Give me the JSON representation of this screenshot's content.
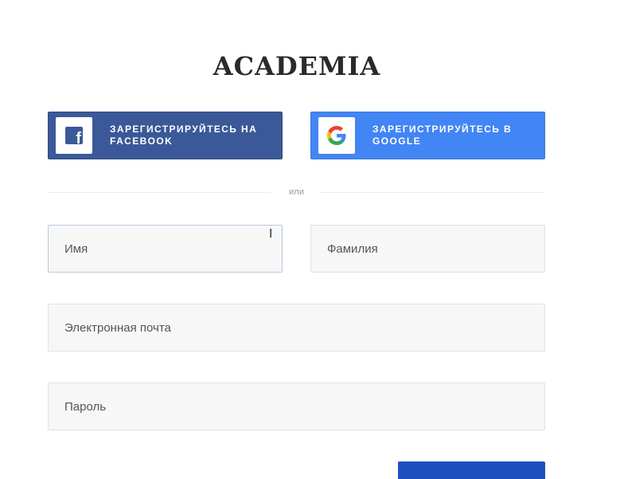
{
  "brand": {
    "logo_text": "ACADEMIA"
  },
  "social": {
    "facebook": {
      "icon": "facebook-icon",
      "label": "ЗАРЕГИСТРИРУЙТЕСЬ НА FACEBOOK",
      "color": "#3b5998"
    },
    "google": {
      "icon": "google-icon",
      "label": "ЗАРЕГИСТРИРУЙТЕСЬ В GOOGLE",
      "color": "#4285f4"
    }
  },
  "divider": {
    "text": "или"
  },
  "form": {
    "first_name": {
      "placeholder": "Имя",
      "value": ""
    },
    "last_name": {
      "placeholder": "Фамилия",
      "value": ""
    },
    "email": {
      "placeholder": "Электронная почта",
      "value": ""
    },
    "password": {
      "placeholder": "Пароль",
      "value": ""
    }
  },
  "submit": {
    "color": "#1f4fbf"
  }
}
